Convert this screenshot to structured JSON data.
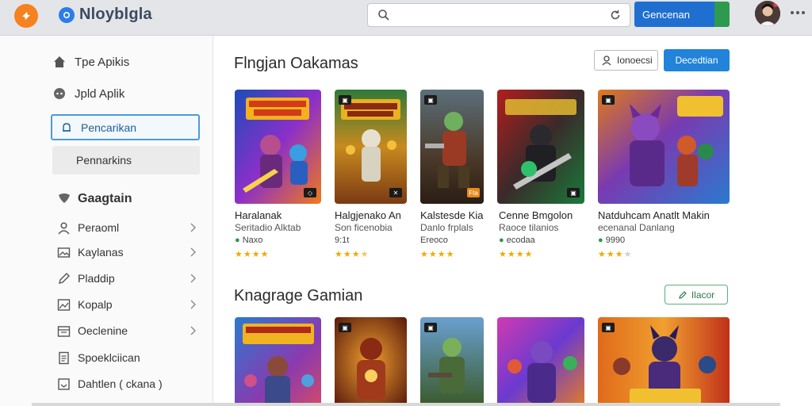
{
  "topbar": {
    "brand": "Nloyblgla",
    "search_placeholder": "",
    "action_button": "Gencenan"
  },
  "sidebar": {
    "items": [
      {
        "label": "Tpe Apikis",
        "icon": "home-icon"
      },
      {
        "label": "Jpld Aplik",
        "icon": "gamepad-icon"
      },
      {
        "label": "Pencarikan",
        "icon": "bell-icon"
      },
      {
        "label": "Pennarkins",
        "icon": ""
      }
    ],
    "section_title": "Gaagtain",
    "categories": [
      {
        "label": "Peraoml",
        "icon": "user-icon"
      },
      {
        "label": "Kaylanas",
        "icon": "image-icon"
      },
      {
        "label": "Pladdip",
        "icon": "pencil-icon"
      },
      {
        "label": "Kopalp",
        "icon": "photo-icon"
      },
      {
        "label": "Oeclenine",
        "icon": "calendar-icon"
      },
      {
        "label": "Spoeklciican",
        "icon": "document-icon"
      },
      {
        "label": "Dahtlen ( ckana )",
        "icon": "archive-icon"
      }
    ]
  },
  "section1": {
    "title": "Flngjan Oakamas",
    "filter_button": "Ionoecsi",
    "action_button": "Decedtian",
    "cards": [
      {
        "title": "Haralanak",
        "subtitle": "Seritadio Alktab",
        "price": "Naxo",
        "rating": 4,
        "badge": "◇"
      },
      {
        "title": "Halgjenako An",
        "subtitle": "Son ficenobia",
        "price": "9:1t",
        "rating": 3.5,
        "badge": "✕"
      },
      {
        "title": "Kalstesde Kia",
        "subtitle": "Danlo frplals",
        "price": "Ereoco",
        "rating": 4,
        "badge": "Fta"
      },
      {
        "title": "Cenne Bmgolon",
        "subtitle": "Raoce tilanios",
        "price": "ecodaa",
        "rating": 4,
        "badge": "▣"
      },
      {
        "title": "Natduhcam Anatlt Makin",
        "subtitle": "ecenanal Danlang",
        "price": "9990",
        "rating": 3,
        "badge": ""
      }
    ]
  },
  "section2": {
    "title": "Knagrage Gamian",
    "action_button": "Ilacor",
    "cards": [
      {
        "badge": "▣"
      },
      {
        "badge": "▣"
      },
      {
        "badge": "▣"
      },
      {
        "badge": ""
      },
      {
        "badge": "▣"
      }
    ]
  },
  "colors": {
    "accent": "#2183d9",
    "star": "#f2a900",
    "topbar": "#e3e5e8",
    "brand_logo": "#f5821f"
  }
}
